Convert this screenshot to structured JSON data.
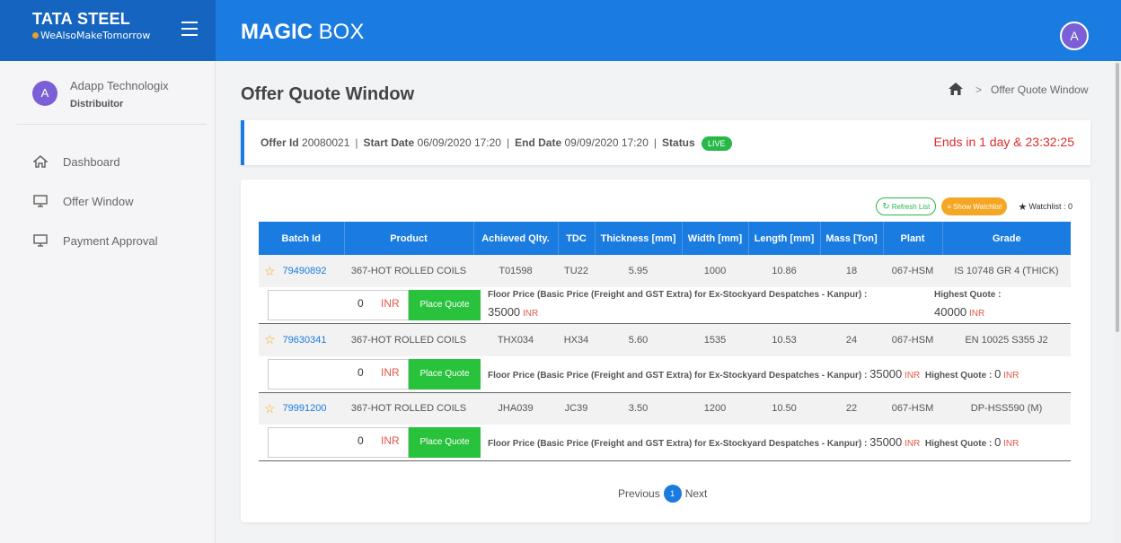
{
  "brand": {
    "name_bold": "TATA",
    "name_rest": "STEEL",
    "tagline": "WeAlsoMakeTomorrow"
  },
  "app": {
    "title_bold": "MAGIC",
    "title_rest": "BOX",
    "avatar_letter": "A"
  },
  "user": {
    "avatar_letter": "A",
    "name": "Adapp Technologix",
    "role": "Distribuitor"
  },
  "sidebar": {
    "items": [
      {
        "label": "Dashboard",
        "icon": "home-icon"
      },
      {
        "label": "Offer Window",
        "icon": "monitor-icon"
      },
      {
        "label": "Payment Approval",
        "icon": "monitor-icon"
      }
    ]
  },
  "page": {
    "title": "Offer Quote Window",
    "breadcrumb": "Offer Quote Window"
  },
  "offer": {
    "id_label": "Offer Id",
    "id": "20080021",
    "start_label": "Start Date",
    "start": "06/09/2020 17:20",
    "end_label": "End Date",
    "end": "09/09/2020 17:20",
    "status_label": "Status",
    "status": "LIVE",
    "countdown": "Ends in 1 day & 23:32:25"
  },
  "actions": {
    "refresh": "Refresh List",
    "watchlist": "Show Watchlist",
    "watch_count": "Watchlist : 0"
  },
  "table": {
    "headers": [
      "Batch Id",
      "Product",
      "Achieved Qlty.",
      "TDC",
      "Thickness [mm]",
      "Width [mm]",
      "Length [mm]",
      "Mass [Ton]",
      "Plant",
      "Grade"
    ],
    "rows": [
      {
        "batch": "79490892",
        "product": "367-HOT ROLLED COILS",
        "qlty": "T01598",
        "tdc": "TU22",
        "thickness": "5.95",
        "width": "1000",
        "length": "10.86",
        "mass": "18",
        "plant": "067-HSM",
        "grade": "IS 10748 GR 4 (THICK)"
      },
      {
        "batch": "79630341",
        "product": "367-HOT ROLLED COILS",
        "qlty": "THX034",
        "tdc": "HX34",
        "thickness": "5.60",
        "width": "1535",
        "length": "10.53",
        "mass": "24",
        "plant": "067-HSM",
        "grade": "EN 10025 S355 J2"
      },
      {
        "batch": "79991200",
        "product": "367-HOT ROLLED COILS",
        "qlty": "JHA039",
        "tdc": "JC39",
        "thickness": "3.50",
        "width": "1200",
        "length": "10.50",
        "mass": "22",
        "plant": "067-HSM",
        "grade": "DP-HSS590 (M)"
      }
    ]
  },
  "quote": {
    "input_value": "0",
    "currency": "INR",
    "button": "Place Quote",
    "floor_label": "Floor Price (Basic Price (Freight and GST Extra) for Ex-Stockyard Despatches - Kanpur) :",
    "floor_value": "35000",
    "highest_label": "Highest Quote :",
    "highest_values": [
      "40000",
      "0",
      "0"
    ]
  },
  "pager": {
    "prev": "Previous",
    "page": "1",
    "next": "Next"
  },
  "colors": {
    "primary": "#1a7be0",
    "success": "#28c23c",
    "warning": "#f5a623",
    "danger": "#e02b2b"
  }
}
